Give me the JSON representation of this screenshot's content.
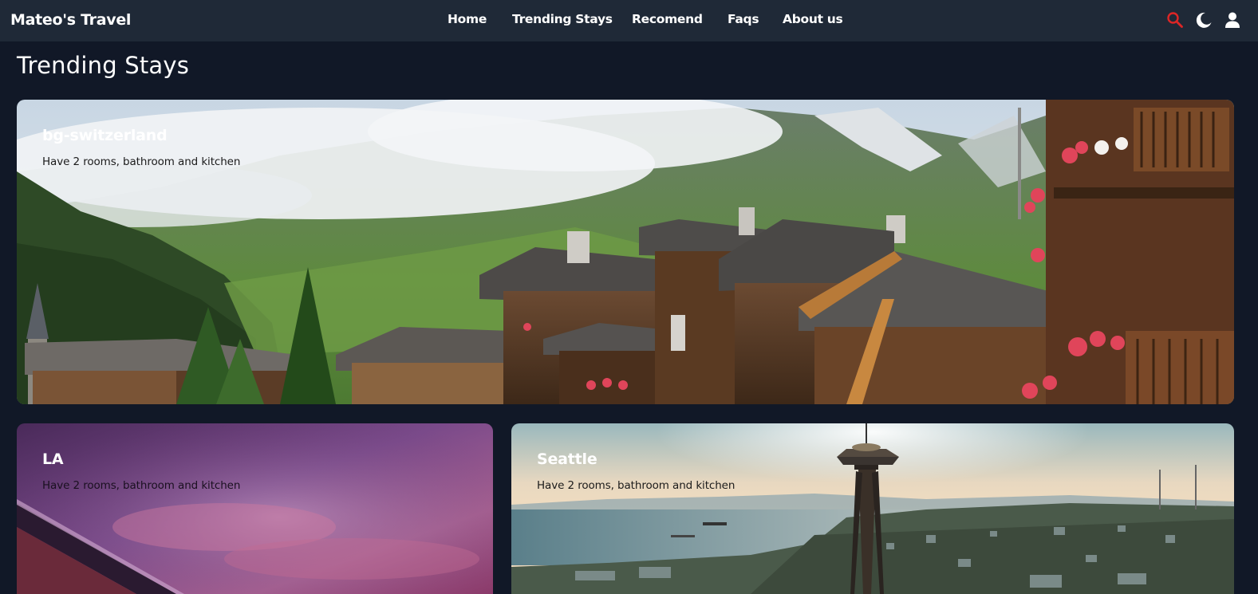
{
  "navbar": {
    "brand": "Mateo's Travel",
    "links": [
      {
        "label": "Home"
      },
      {
        "label": "Trending Stays"
      },
      {
        "label": "Recomend"
      },
      {
        "label": "Faqs"
      },
      {
        "label": "About us"
      }
    ],
    "icons": {
      "search": "search-icon",
      "theme": "moon-icon",
      "user": "user-icon"
    },
    "search_icon_color": "#dc2626"
  },
  "page": {
    "title": "Trending Stays"
  },
  "cards": [
    {
      "title": "bg-switzerland",
      "description": "Have 2 rooms, bathroom and kitchen",
      "image": "swiss-alpine-village"
    },
    {
      "title": "LA",
      "description": "Have 2 rooms, bathroom and kitchen",
      "image": "purple-sunset-sky"
    },
    {
      "title": "Seattle",
      "description": "Have 2 rooms, bathroom and kitchen",
      "image": "seattle-space-needle"
    }
  ],
  "colors": {
    "background": "#111827",
    "navbar": "#1f2937",
    "text": "#ffffff"
  }
}
